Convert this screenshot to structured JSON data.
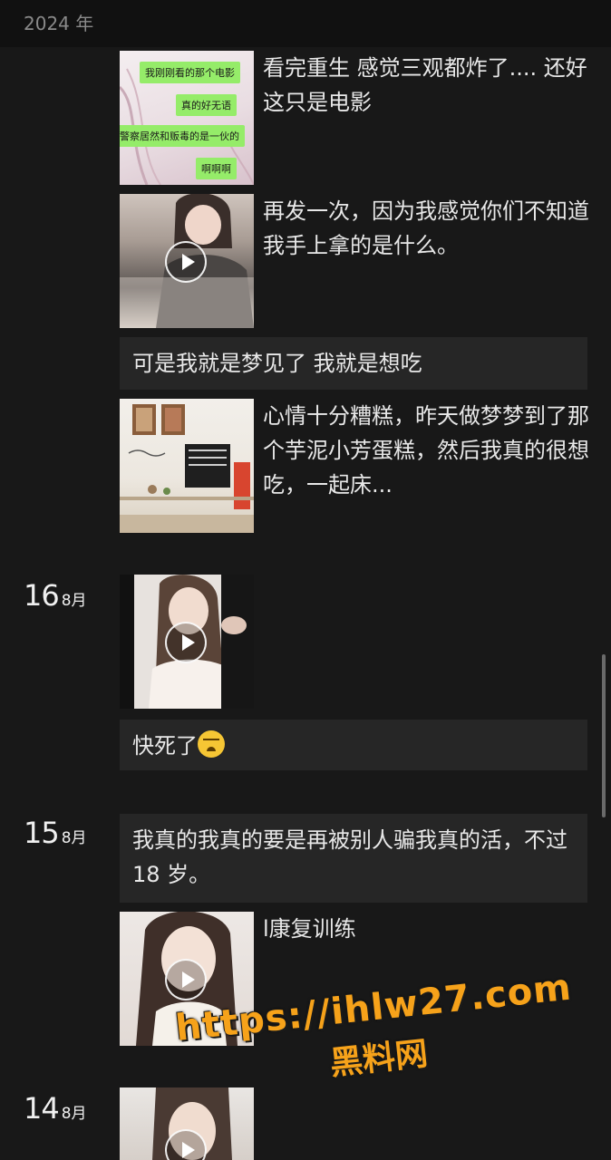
{
  "header": {
    "year": "2024 年"
  },
  "dates": [
    {
      "day": "16",
      "month": "8月"
    },
    {
      "day": "15",
      "month": "8月"
    },
    {
      "day": "14",
      "month": "8月"
    }
  ],
  "posts": [
    {
      "caption": "看完重生 感觉三观都炸了.... 还好这只是电影",
      "chat_lines": [
        "我刚刚看的那个电影",
        "真的好无语",
        "警察居然和贩毒的是一伙的",
        "啊啊啊"
      ]
    },
    {
      "caption": "再发一次，因为我感觉你们不知道我手上拿的是什么。"
    },
    {
      "text": "可是我就是梦见了 我就是想吃"
    },
    {
      "caption": "心情十分糟糕，昨天做梦梦到了那个芋泥小芳蛋糕，然后我真的很想吃，一起床..."
    },
    {
      "text": "快死了"
    },
    {
      "text": "我真的我真的要是再被别人骗我真的活，不过 18 岁。"
    },
    {
      "caption": "l康复训练"
    }
  ],
  "watermark": {
    "url": "https://ihlw27.com",
    "name": "黑料网"
  },
  "colors": {
    "background": "#181818",
    "header_bg": "#111111",
    "text_card_bg": "#262626",
    "chat_bubble": "#95ec69",
    "watermark": "#f6a21a"
  }
}
